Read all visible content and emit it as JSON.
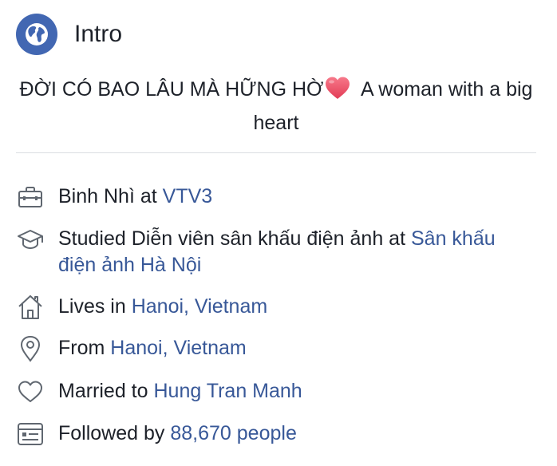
{
  "intro": {
    "title": "Intro",
    "icon": "globe-icon",
    "bio_text": "ĐỜI CÓ BAO LÂU MÀ HỮNG HỜ",
    "bio_emoji": "heart-emoji",
    "bio_tail": " A woman with a big heart"
  },
  "details": {
    "work": {
      "icon": "briefcase-icon",
      "prefix": "Binh Nhì at ",
      "link": "VTV3"
    },
    "education": {
      "icon": "graduation-cap-icon",
      "prefix": "Studied Diễn viên sân khấu điện ảnh at ",
      "link": "Sân khấu điện ảnh Hà Nội"
    },
    "lives": {
      "icon": "home-icon",
      "prefix": "Lives in ",
      "link": "Hanoi, Vietnam"
    },
    "from": {
      "icon": "location-pin-icon",
      "prefix": "From ",
      "link": "Hanoi, Vietnam"
    },
    "relationship": {
      "icon": "heart-icon",
      "prefix": "Married to ",
      "link": "Hung Tran Manh"
    },
    "followers": {
      "icon": "rss-feed-icon",
      "prefix": "Followed by ",
      "link": "88,670 people"
    }
  },
  "colors": {
    "brand_blue": "#4267b2",
    "link": "#385898",
    "text": "#1d2129",
    "icon_gray": "#606770",
    "heart_pink": "#f25268",
    "divider": "#dadde1"
  }
}
